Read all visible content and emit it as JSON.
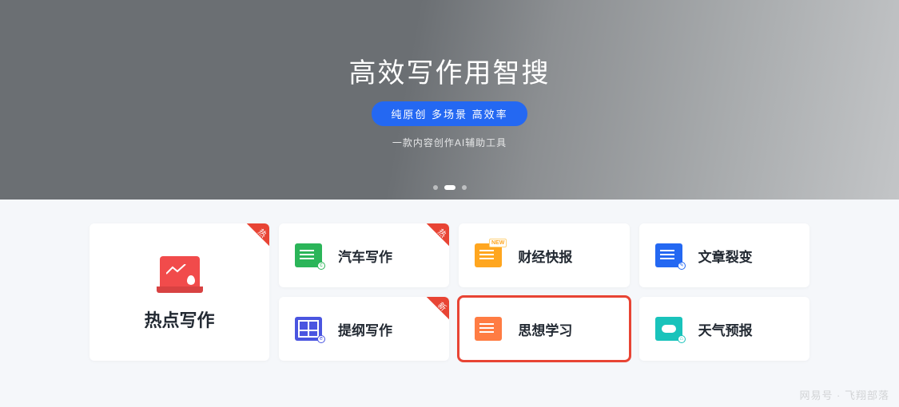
{
  "hero": {
    "title": "高效写作用智搜",
    "pill": "纯原创 多场景 高效率",
    "sub": "一款内容创作AI辅助工具"
  },
  "ribbons": {
    "hot": "热",
    "new": "新"
  },
  "cards": {
    "big": {
      "label": "热点写作",
      "icon": "hot-writing-icon",
      "ribbon": "hot"
    },
    "r1c1": {
      "label": "汽车写作",
      "icon": "car-writing-icon",
      "ribbon": "hot"
    },
    "r1c2": {
      "label": "财经快报",
      "icon": "finance-news-icon",
      "ribbon": null
    },
    "r1c3": {
      "label": "文章裂变",
      "icon": "article-split-icon",
      "ribbon": null
    },
    "r2c1": {
      "label": "提纲写作",
      "icon": "outline-writing-icon",
      "ribbon": "new"
    },
    "r2c2": {
      "label": "思想学习",
      "icon": "thought-study-icon",
      "ribbon": null,
      "highlighted": true
    },
    "r2c3": {
      "label": "天气预报",
      "icon": "weather-icon",
      "ribbon": null
    }
  },
  "watermark": "网易号 · 飞翔部落"
}
